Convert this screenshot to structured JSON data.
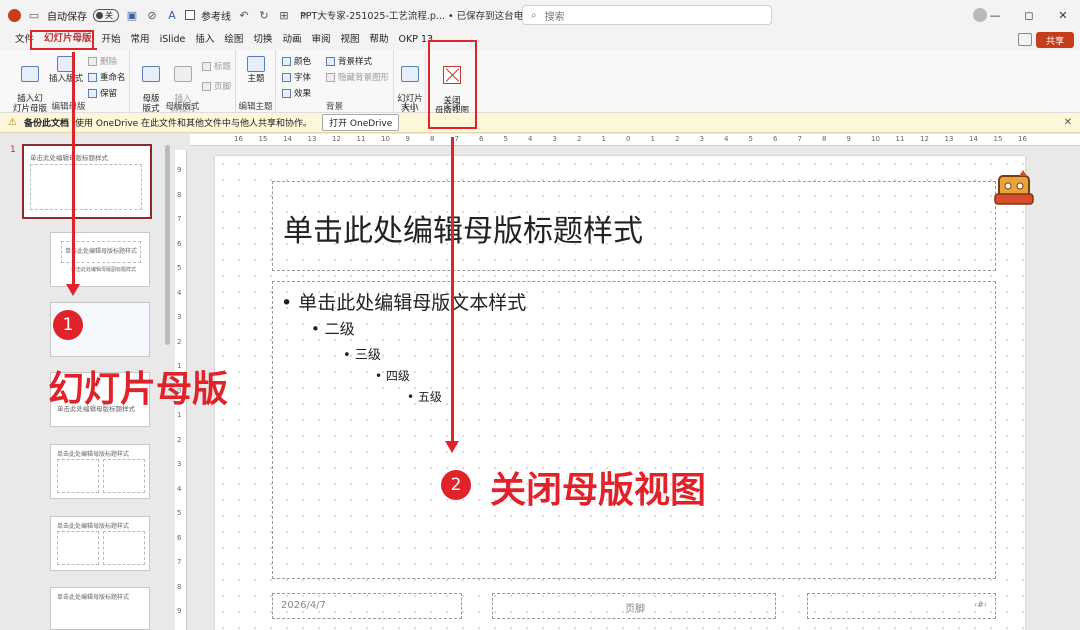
{
  "titlebar": {
    "autosave_label": "自动保存",
    "autosave_state": "关",
    "reference_label": "参考线",
    "doc_title": "PPT大专家-251025-工艺流程.p...  •  已保存到这台电脑 ⌄",
    "search_placeholder": "搜索",
    "minimize": "—",
    "maximize": "◻",
    "close": "✕"
  },
  "menu": {
    "items": [
      "文件",
      "幻灯片母版",
      "开始",
      "常用",
      "iSlide",
      "插入",
      "绘图",
      "切换",
      "动画",
      "审阅",
      "视图",
      "帮助",
      "OKP 13"
    ],
    "share": "共享"
  },
  "ribbon": {
    "insert_master": "插入幻\n灯片母版",
    "insert_layout": "插入版式",
    "delete": "删除",
    "rename": "重命名",
    "preserve": "保留",
    "group_edit_master": "编辑母版",
    "master_layout": "母版\n版式",
    "insert_placeholder": "插入\n占位符",
    "title_cb": "标题",
    "footer_cb": "页脚",
    "group_master_layout": "母版版式",
    "theme": "主题",
    "group_edit_theme": "编辑主题",
    "colors": "颜色",
    "fonts": "字体",
    "effects": "效果",
    "bg_styles": "背景样式",
    "hide_bg": "隐藏背景图形",
    "group_background": "背景",
    "slide_size": "幻灯片\n大小",
    "group_size": "大小",
    "close_master": "关闭\n母版视图",
    "group_close": "关闭"
  },
  "notification": {
    "bold": "备份此文档",
    "text": "使用 OneDrive 在此文件和其他文件中与他人共享和协作。",
    "button": "打开 OneDrive",
    "close": "✕"
  },
  "thumbnails": {
    "slide_number": "1",
    "master_title": "单击此处编辑母版标题样式",
    "layout_title": "单击此处编辑母版标题样式",
    "layout_sub": "单击此处编辑母版副标题样式"
  },
  "ruler": {
    "h": [
      "16",
      "15",
      "14",
      "13",
      "12",
      "11",
      "10",
      "9",
      "8",
      "7",
      "6",
      "5",
      "4",
      "3",
      "2",
      "1",
      "0",
      "1",
      "2",
      "3",
      "4",
      "5",
      "6",
      "7",
      "8",
      "9",
      "10",
      "11",
      "12",
      "13",
      "14",
      "15",
      "16"
    ],
    "v": [
      "9",
      "8",
      "7",
      "6",
      "5",
      "4",
      "3",
      "2",
      "1",
      "0",
      "1",
      "2",
      "3",
      "4",
      "5",
      "6",
      "7",
      "8",
      "9"
    ]
  },
  "slide": {
    "title": "单击此处编辑母版标题样式",
    "level1": "单击此处编辑母版文本样式",
    "level2": "二级",
    "level3": "三级",
    "level4": "四级",
    "level5": "五级",
    "date": "2026/4/7",
    "footer": "页脚",
    "number": "‹#›"
  },
  "annotations": {
    "badge1": "1",
    "callout1": "幻灯片母版",
    "badge2": "2",
    "callout2": "关闭母版视图",
    "color": "#e0232a"
  }
}
